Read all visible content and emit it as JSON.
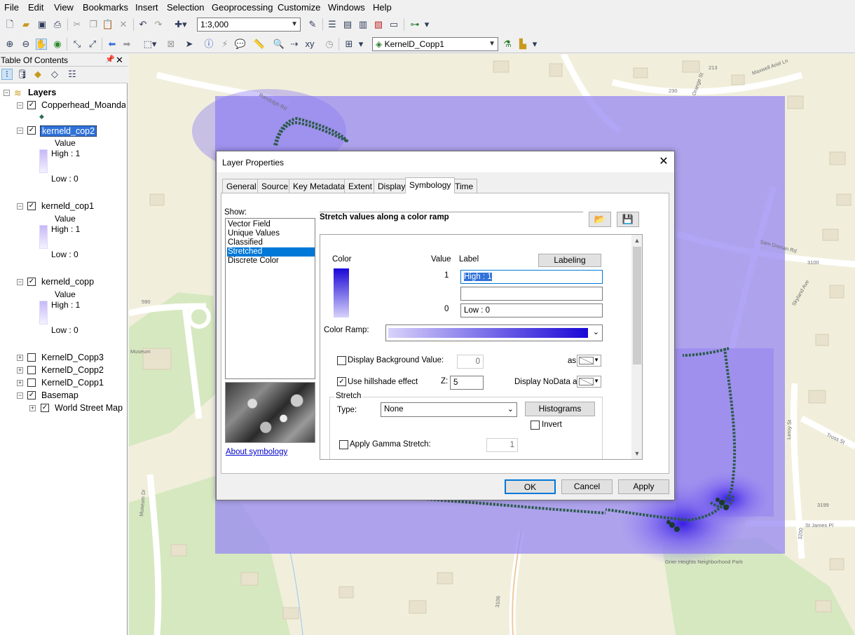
{
  "menu": [
    "File",
    "Edit",
    "View",
    "Bookmarks",
    "Insert",
    "Selection",
    "Geoprocessing",
    "Customize",
    "Windows",
    "Help"
  ],
  "toolbar": {
    "scale": "1:3,000",
    "layer_select": "KernelD_Copp1"
  },
  "toc": {
    "title": "Table Of Contents",
    "root": "Layers",
    "layers": [
      {
        "name": "Copperhead_Moanday"
      },
      {
        "name": "kerneld_cop2",
        "field": "Value",
        "high": "High : 1",
        "low": "Low : 0"
      },
      {
        "name": "kerneld_cop1",
        "field": "Value",
        "high": "High : 1",
        "low": "Low : 0"
      },
      {
        "name": "kerneld_copp",
        "field": "Value",
        "high": "High : 1",
        "low": "Low : 0"
      },
      {
        "name": "KernelD_Copp3"
      },
      {
        "name": "KernelD_Copp2"
      },
      {
        "name": "KernelD_Copp1"
      },
      {
        "name": "Basemap"
      },
      {
        "name": "World Street Map"
      }
    ]
  },
  "map_labels": {
    "randolph": "Randolph Rd",
    "maxwell": "Maxwell Ariel Ln",
    "orange": "Orange St",
    "sam_drenan": "Sam Drenan Rd",
    "skyland": "Skyland Ave",
    "leroy": "Leroy St",
    "st_james": "St James Pl",
    "tross": "Tross St",
    "museum_dr": "Museum Dr",
    "museum": "Museum",
    "park": "Grier Heights Neighborhood Park",
    "n590": "590",
    "n3100": "3100",
    "n3199": "3199",
    "n3200": "3200",
    "n3106": "3106",
    "n230": "230",
    "n213": "213"
  },
  "dialog": {
    "title": "Layer Properties",
    "tabs": [
      "General",
      "Source",
      "Key Metadata",
      "Extent",
      "Display",
      "Symbology",
      "Time"
    ],
    "active_tab": "Symbology",
    "show_label": "Show:",
    "show_items": [
      "Vector Field",
      "Unique Values",
      "Classified",
      "Stretched",
      "Discrete Color"
    ],
    "selected_show": "Stretched",
    "about": "About symbology",
    "panel_title": "Stretch values along a color ramp",
    "color_header": "Color",
    "value_header": "Value",
    "label_header": "Label",
    "labeling_btn": "Labeling",
    "high_value": "1",
    "high_label": "High : 1",
    "mid_label": "",
    "low_value": "0",
    "low_label": "Low : 0",
    "color_ramp_label": "Color Ramp:",
    "bg_value_label": "Display Background Value:",
    "bg_value": "0",
    "as_label": "as",
    "hillshade_label": "Use hillshade effect",
    "z_label": "Z:",
    "z_value": "5",
    "nodata_label": "Display NoData as",
    "stretch_group": "Stretch",
    "type_label": "Type:",
    "type_value": "None",
    "histograms_btn": "Histograms",
    "invert_label": "Invert",
    "gamma_label": "Apply Gamma Stretch:",
    "gamma_value": "1",
    "ok": "OK",
    "cancel": "Cancel",
    "apply": "Apply",
    "colors": {
      "ramp_from": "#d8d2fb",
      "ramp_to": "#1a08d6",
      "selection": "#0078d7"
    }
  }
}
